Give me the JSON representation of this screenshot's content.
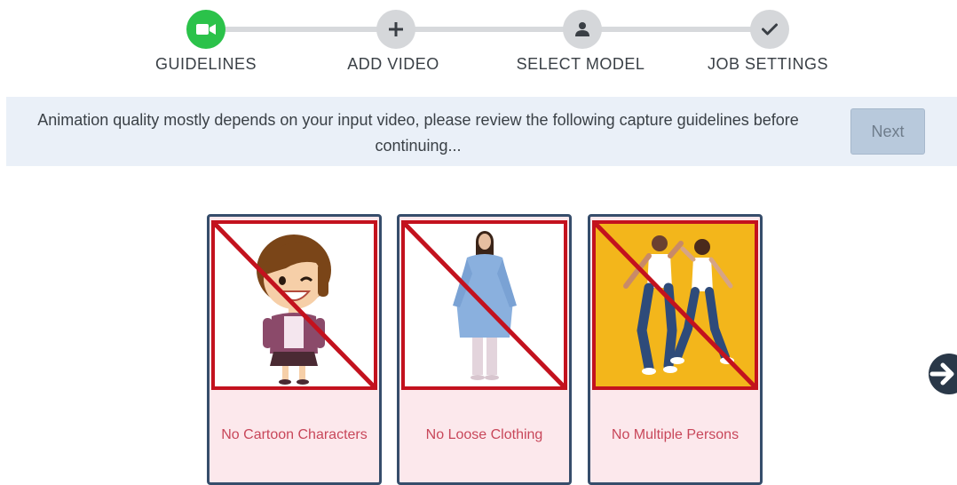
{
  "stepper": {
    "steps": [
      {
        "label": "GUIDELINES",
        "icon": "video-camera-icon",
        "active": true
      },
      {
        "label": "ADD VIDEO",
        "icon": "plus-icon",
        "active": false
      },
      {
        "label": "SELECT MODEL",
        "icon": "user-icon",
        "active": false
      },
      {
        "label": "JOB SETTINGS",
        "icon": "checkmark-icon",
        "active": false
      }
    ],
    "active_color": "#2bc24a",
    "inactive_color": "#d5d7da"
  },
  "banner": {
    "message": "Animation quality mostly depends on your input video, please review the following capture guidelines before continuing...",
    "next_label": "Next"
  },
  "cards": [
    {
      "caption": "No Cartoon Characters",
      "image": "cartoon-character-illustration"
    },
    {
      "caption": "No Loose Clothing",
      "image": "loose-clothing-photo"
    },
    {
      "caption": "No Multiple Persons",
      "image": "multiple-persons-photo"
    }
  ],
  "colors": {
    "prohibit_red": "#c3121e",
    "card_border": "#364d6b",
    "caption_text": "#c8475a",
    "card_background": "#fce8ec"
  },
  "carousel": {
    "next_icon": "arrow-right-circle-icon"
  }
}
